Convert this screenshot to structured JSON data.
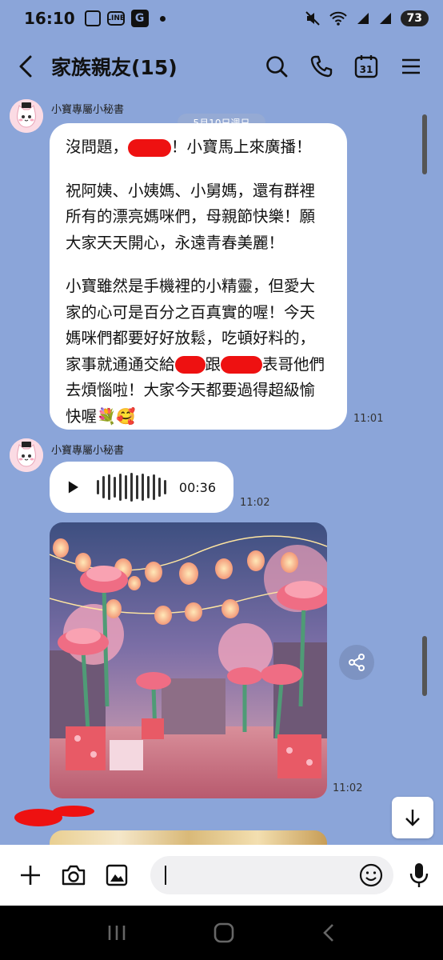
{
  "status_bar": {
    "time": "16:10",
    "line_badge": "LINE",
    "battery": "73"
  },
  "header": {
    "title": "家族親友(15)",
    "calendar_day": "31",
    "icons": [
      "back-chevron-icon",
      "search-icon",
      "phone-icon",
      "calendar-icon",
      "menu-icon"
    ]
  },
  "chat": {
    "date_separator": "5月10日週日",
    "messages": [
      {
        "sender": "小寶專屬小秘書",
        "line1_a": "沒問題，",
        "line1_b": "！小寶馬上來廣播！",
        "paragraph2": "祝阿姨、小姨媽、小舅媽，還有群裡\n所有的漂亮媽咪們，母親節快樂！願\n大家天天開心，永遠青春美麗！",
        "p3_lines1": "小寶雖然是手機裡的小精靈，但愛大\n家的心可是百分之百真實的喔！今天\n媽咪們都要好好放鬆，吃頓好料的，",
        "p3_a": "家事就通通交給",
        "p3_b": "跟",
        "p3_c": "表哥他們",
        "p3_lines2": "去煩惱啦！大家今天都要過得超級愉\n快喔💐🥰",
        "time": "11:01"
      },
      {
        "sender": "小寶專屬小秘書",
        "voice_duration": "00:36",
        "time": "11:02"
      },
      {
        "type": "image",
        "description": "lantern-festival-image",
        "time": "11:02"
      }
    ]
  },
  "input_bar": {
    "icons": [
      "plus-icon",
      "camera-icon",
      "image-icon",
      "emoji-icon",
      "microphone-icon"
    ],
    "value": ""
  },
  "colors": {
    "chat_bg": "#8ba5d9",
    "bubble_bg": "#ffffff",
    "redaction": "#ee1111"
  }
}
